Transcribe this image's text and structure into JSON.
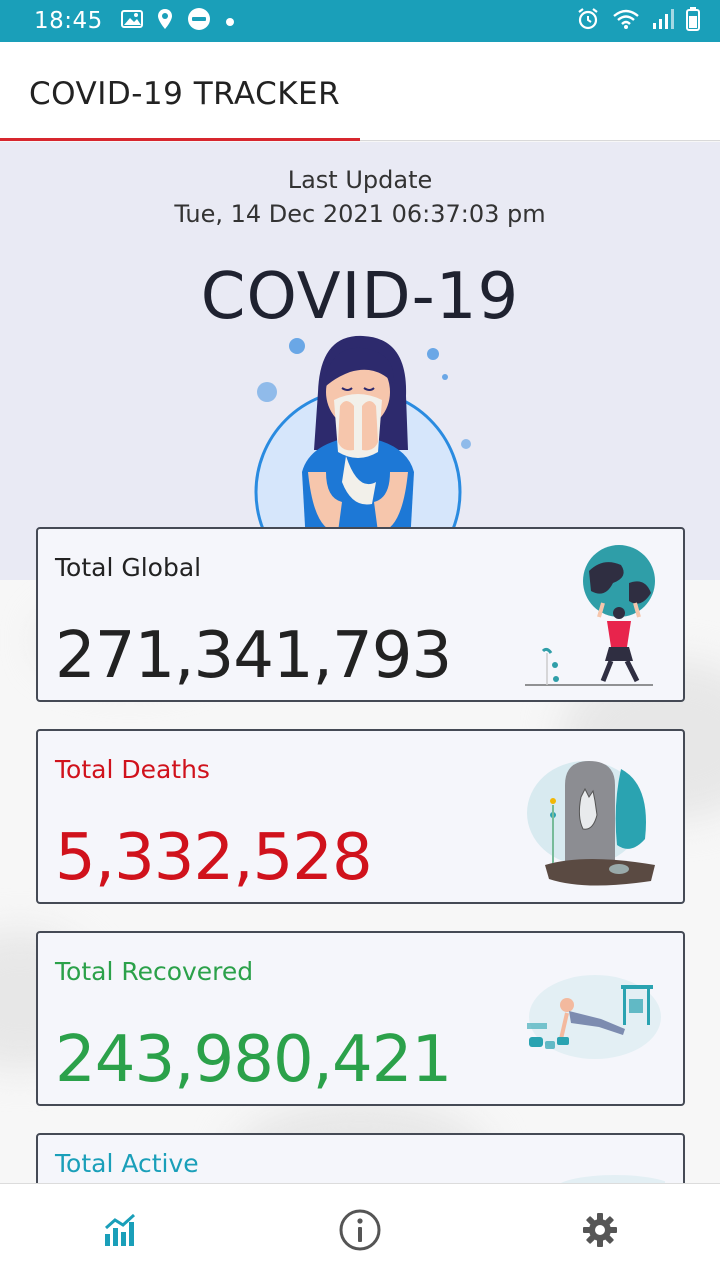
{
  "status_bar": {
    "time": "18:45",
    "left_icons": [
      "image-icon",
      "location-pin-icon",
      "app-badge-icon",
      "dot-icon"
    ],
    "right_icons": [
      "alarm-icon",
      "wifi-icon",
      "signal-icon",
      "battery-icon"
    ],
    "color": "#1a9fb9"
  },
  "app_bar": {
    "title": "COVID-19 TRACKER",
    "accent": "#d7262e"
  },
  "hero": {
    "last_update_label": "Last Update",
    "last_update_value": "Tue, 14 Dec 2021 06:37:03 pm",
    "title": "COVID-19",
    "illustration": "woman-sneezing-illustration"
  },
  "cards": [
    {
      "label": "Total Global",
      "value": "271,341,793",
      "color": "#222222",
      "illustration": "person-holding-globe-illustration"
    },
    {
      "label": "Total Deaths",
      "value": "5,332,528",
      "color": "#d0121c",
      "illustration": "tombstone-hand-illustration"
    },
    {
      "label": "Total Recovered",
      "value": "243,980,421",
      "color": "#2ba14a",
      "illustration": "pushup-exercise-illustration"
    },
    {
      "label": "Total Active",
      "color": "#1a9fb9",
      "illustration": "laptop-illustration"
    }
  ],
  "bottom_nav": {
    "items": [
      {
        "icon": "bar-chart-icon",
        "active": true,
        "color": "#1a9fb9"
      },
      {
        "icon": "info-icon",
        "active": false,
        "color": "#555555"
      },
      {
        "icon": "gear-icon",
        "active": false,
        "color": "#555555"
      }
    ]
  }
}
